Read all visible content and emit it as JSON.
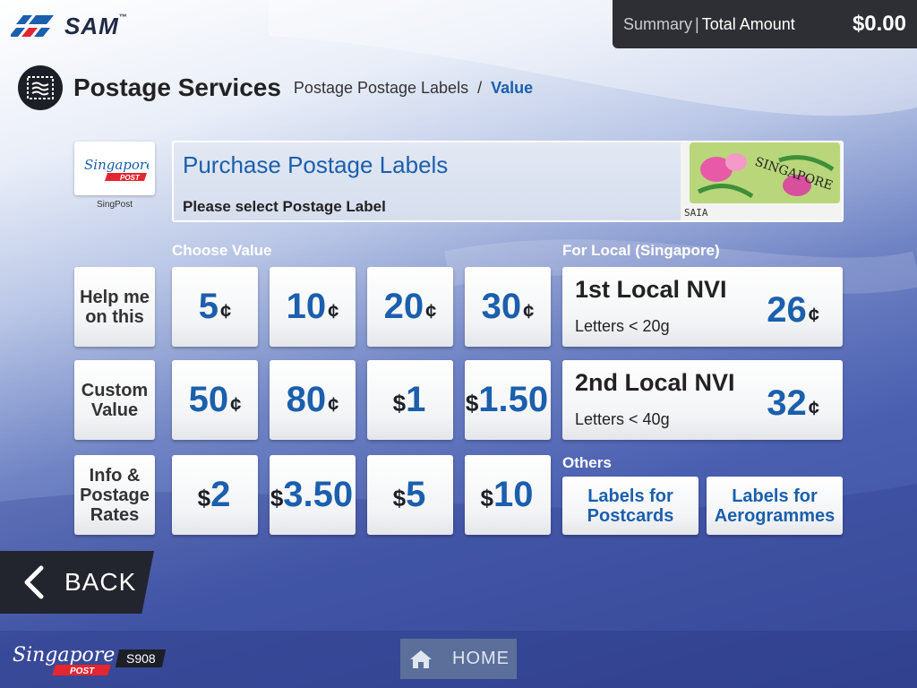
{
  "header": {
    "brand": "SAM",
    "brand_mark": "™",
    "summary_label": "Summary",
    "summary_sep": "|",
    "total_label": "Total Amount",
    "total_amount": "$0.00"
  },
  "breadcrumb": {
    "title": "Postage Services",
    "path": "Postage Postage Labels",
    "sep": "/",
    "current": "Value",
    "icon": "stamp-icon"
  },
  "provider": {
    "logo_text": "Singapore",
    "logo_sub": "POST",
    "label": "SingPost"
  },
  "banner": {
    "title": "Purchase Postage Labels",
    "subtitle": "Please select Postage Label",
    "art_text": "SINGAPORE",
    "art_code": "SAIA"
  },
  "section_labels": {
    "choose": "Choose Value",
    "local": "For Local (Singapore)",
    "others": "Others"
  },
  "side_buttons": [
    {
      "line1": "Help me",
      "line2": "on this",
      "line3": ""
    },
    {
      "line1": "Custom",
      "line2": "Value",
      "line3": ""
    },
    {
      "line1": "Info &",
      "line2": "Postage",
      "line3": "Rates"
    }
  ],
  "values": [
    {
      "cur": "",
      "num": "5",
      "cents": "¢"
    },
    {
      "cur": "",
      "num": "10",
      "cents": "¢"
    },
    {
      "cur": "",
      "num": "20",
      "cents": "¢"
    },
    {
      "cur": "",
      "num": "30",
      "cents": "¢"
    },
    {
      "cur": "",
      "num": "50",
      "cents": "¢"
    },
    {
      "cur": "",
      "num": "80",
      "cents": "¢"
    },
    {
      "cur": "$",
      "num": "1",
      "cents": ""
    },
    {
      "cur": "$",
      "num": "1.50",
      "cents": ""
    },
    {
      "cur": "$",
      "num": "2",
      "cents": ""
    },
    {
      "cur": "$",
      "num": "3.50",
      "cents": ""
    },
    {
      "cur": "$",
      "num": "5",
      "cents": ""
    },
    {
      "cur": "$",
      "num": "10",
      "cents": ""
    }
  ],
  "local": [
    {
      "name": "1st Local NVI",
      "note": "Letters < 20g",
      "num": "26",
      "cents": "¢"
    },
    {
      "name": "2nd Local NVI",
      "note": "Letters < 40g",
      "num": "32",
      "cents": "¢"
    }
  ],
  "others": [
    {
      "line1": "Labels for",
      "line2": "Postcards"
    },
    {
      "line1": "Labels for",
      "line2": "Aerogrammes"
    }
  ],
  "back": {
    "label": "BACK",
    "icon": "chevron-left-icon"
  },
  "footer": {
    "logo_text": "Singapore",
    "logo_sub": "POST",
    "kiosk_id": "S908",
    "home_label": "HOME",
    "home_icon": "home-icon"
  },
  "colors": {
    "accent": "#1b5fad",
    "dark": "#1c1f26",
    "brand_red": "#e3262f"
  }
}
